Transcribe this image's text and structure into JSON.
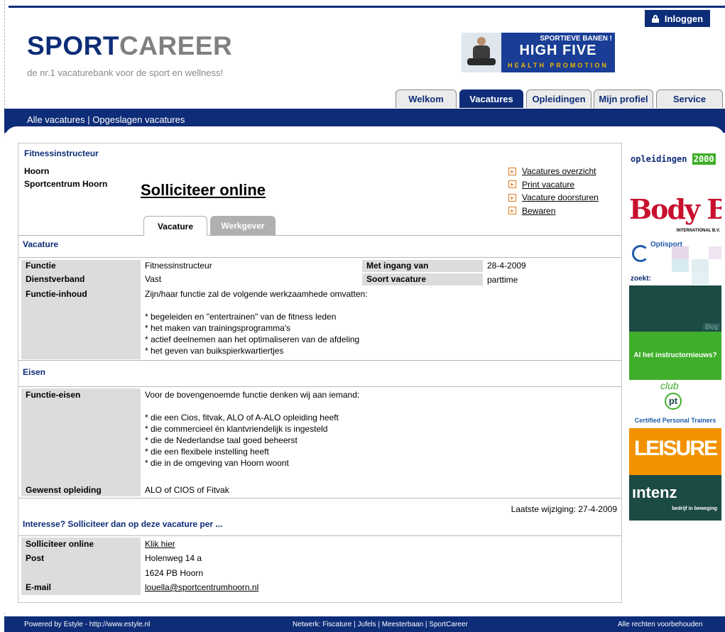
{
  "header": {
    "login_label": "Inloggen",
    "logo_sport": "SPORT",
    "logo_career": "CAREER",
    "tagline": "de nr.1 vacaturebank voor de sport en wellness!",
    "banner": {
      "top": "SPORTIEVE BANEN !",
      "brand": "HIGH FIVE",
      "sub": "HEALTH PROMOTION"
    }
  },
  "nav": {
    "tabs": [
      {
        "label": "Welkom",
        "active": false
      },
      {
        "label": "Vacatures",
        "active": true
      },
      {
        "label": "Opleidingen",
        "active": false
      },
      {
        "label": "Mijn profiel",
        "active": false
      },
      {
        "label": "Service",
        "active": false
      }
    ],
    "sub_all": "Alle vacatures",
    "sub_sep": " | ",
    "sub_saved": "Opgeslagen vacatures"
  },
  "job": {
    "title": "Fitnessinstructeur",
    "city": "Hoorn",
    "company": "Sportcentrum Hoorn",
    "apply_label": "Solliciteer online",
    "links": [
      "Vacatures overzicht",
      "Print vacature",
      "Vacature doorsturen",
      "Bewaren"
    ],
    "tabs": {
      "active": "Vacature",
      "inactive": "Werkgever"
    }
  },
  "vacature": {
    "section_title": "Vacature",
    "functie_label": "Functie",
    "functie_value": "Fitnessinstructeur",
    "ingang_label": "Met ingang van",
    "ingang_value": "28-4-2009",
    "dienst_label": "Dienstverband",
    "dienst_value": "Vast",
    "soort_label": "Soort vacature",
    "soort_value": "parttime",
    "inhoud_label": "Functie-inhoud",
    "inhoud_value": "Zijn/haar functie zal de volgende werkzaamhede omvatten:\n\n* begeleiden en \"entertrainen\" van de fitness leden\n* het maken van trainingsprogramma's\n* actief deelnemen aan het optimaliseren van de afdeling\n* het geven van buikspierkwartiertjes"
  },
  "eisen": {
    "section_title": "Eisen",
    "eisen_label": "Functie-eisen",
    "eisen_value": "Voor de bovengenoemde functie denken wij aan iemand:\n\n* die een Cios, fitvak, ALO of A-ALO opleiding heeft\n* die commercieel èn klantvriendelijk is ingesteld\n* die de Nederlandse taal goed beheerst\n* die een flexibele instelling heeft\n* die in de omgeving van Hoorn woont",
    "opleiding_label": "Gewenst opleiding",
    "opleiding_value": "ALO of CIOS of Fitvak"
  },
  "last_modified": "Laatste wijziging: 27-4-2009",
  "interesse": {
    "title": "Interesse?  Solliciteer dan op deze vacature per ...",
    "online_label": "Solliciteer online",
    "online_link": "Klik hier",
    "post_label": "Post",
    "post_line1": "Holenweg 14 a",
    "post_line2": "1624 PB Hoorn",
    "email_label": "E-mail",
    "email_value": "louella@sportcentrumhoorn.nl"
  },
  "ads": {
    "opleidingen_a": "opleidingen",
    "opleidingen_b": "2000",
    "bodybiz": "Body Biz",
    "bodybiz_sub": "INTERNATIONAL B.V.",
    "optisport": "Optisport",
    "zoekt": "zoekt:",
    "blog": "Blog",
    "instructor": "Al het instructornieuws?",
    "club": "club",
    "pt": "pt",
    "cpt": "Certified Personal Trainers",
    "leisure": "LEISURE",
    "intenz": "ıntenz",
    "intenz_sub": "bedrijf in beweging",
    "colors": {
      "blue": "#0e2d78",
      "green": "#3fae2a",
      "orange": "#f39200",
      "teal": "#1c4a44",
      "bodybiz": "#c8102e"
    }
  },
  "footer": {
    "powered": "Powered by Estyle - http://www.estyle.nl",
    "network": "Netwerk: Fiscature | Jufels | Meesterbaan | SportCareer",
    "rights": "Alle rechten voorbehouden"
  }
}
